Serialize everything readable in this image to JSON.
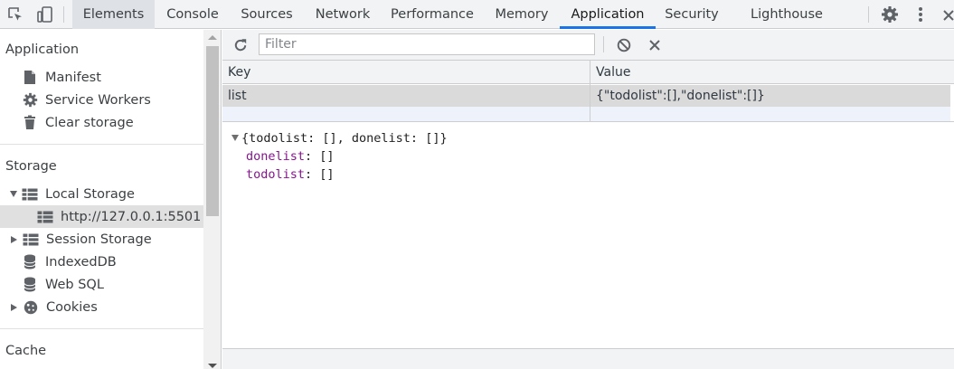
{
  "toolbar": {
    "tabs": [
      "Elements",
      "Console",
      "Sources",
      "Network",
      "Performance",
      "Memory",
      "Application",
      "Security",
      "Lighthouse"
    ],
    "active_tab": "Application",
    "icons": [
      "inspect-element-icon",
      "device-toolbar-icon",
      "settings-gear-icon",
      "more-options-icon",
      "close-icon"
    ]
  },
  "sidebar": {
    "application_heading": "Application",
    "application_items": [
      {
        "label": "Manifest",
        "icon": "file-icon"
      },
      {
        "label": "Service Workers",
        "icon": "gear-icon"
      },
      {
        "label": "Clear storage",
        "icon": "trash-icon"
      }
    ],
    "storage_heading": "Storage",
    "storage_items": [
      {
        "label": "Local Storage",
        "icon": "grid-icon",
        "expanded": true
      },
      {
        "label": "http://127.0.0.1:5501",
        "icon": "grid-icon",
        "selected": true
      },
      {
        "label": "Session Storage",
        "icon": "grid-icon",
        "expanded": false
      },
      {
        "label": "IndexedDB",
        "icon": "database-icon"
      },
      {
        "label": "Web SQL",
        "icon": "database-icon"
      },
      {
        "label": "Cookies",
        "icon": "cookie-icon",
        "expanded": false
      }
    ],
    "cache_heading": "Cache"
  },
  "filter": {
    "placeholder": "Filter",
    "value": ""
  },
  "table": {
    "columns": [
      "Key",
      "Value"
    ],
    "rows": [
      {
        "key": "list",
        "value": "{\"todolist\":[],\"donelist\":[]}"
      }
    ]
  },
  "preview": {
    "summary": "{todolist: [], donelist: []}",
    "props": [
      {
        "key": "donelist",
        "value": "[]"
      },
      {
        "key": "todolist",
        "value": "[]"
      }
    ]
  },
  "colors": {
    "accent": "#1a73e8",
    "property_key": "#881391"
  }
}
